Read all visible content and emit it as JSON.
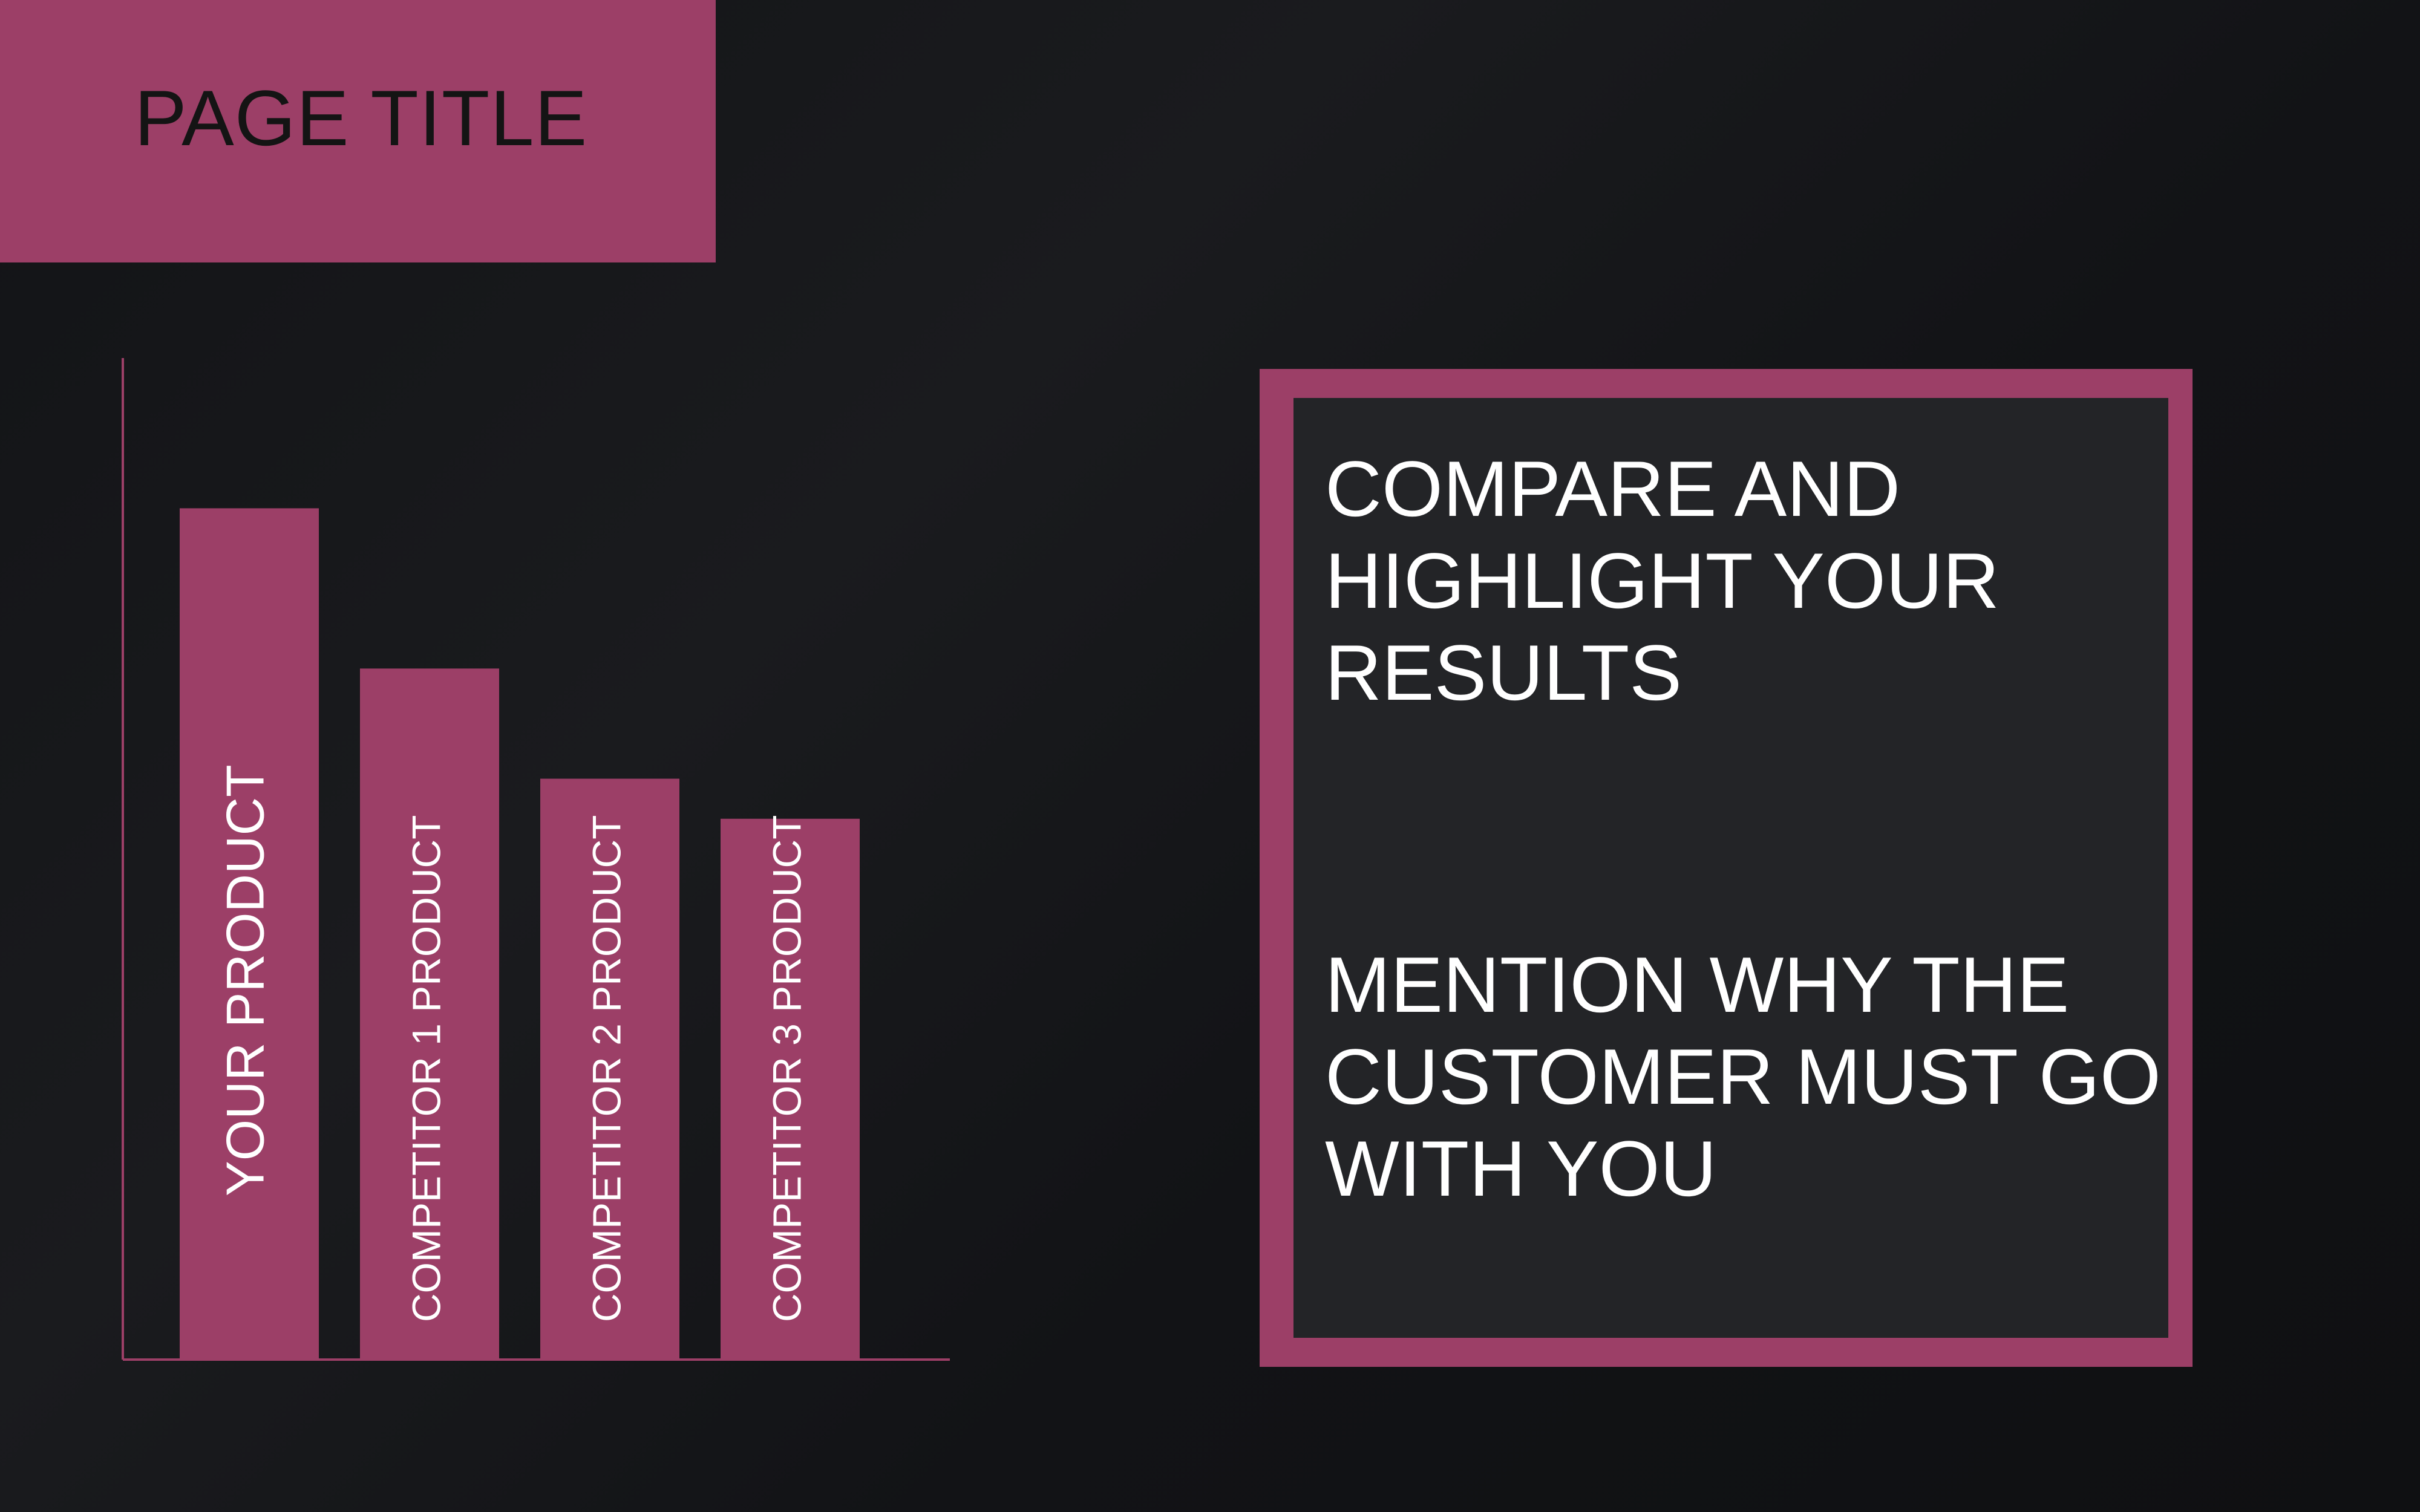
{
  "page_title": "PAGE TITLE",
  "panel": {
    "text_1": "COMPARE AND HIGHLIGHT YOUR RESULTS",
    "text_2": "MENTION WHY THE CUSTOMER MUST GO WITH YOU"
  },
  "colors": {
    "accent": "#9c3f67",
    "background": "#121316",
    "panel_background": "#232427",
    "bar_label": "#ffffff"
  },
  "chart_data": {
    "type": "bar",
    "categories": [
      "YOUR PRODUCT",
      "COMPETITOR 1 PRODUCT",
      "COMPETITOR 2 PRODUCT",
      "COMPETITOR 3 PRODUCT"
    ],
    "values": [
      85,
      69,
      58,
      54
    ],
    "ylim": [
      0,
      100
    ],
    "grid": false,
    "legend": "none",
    "tick_labels": false
  }
}
